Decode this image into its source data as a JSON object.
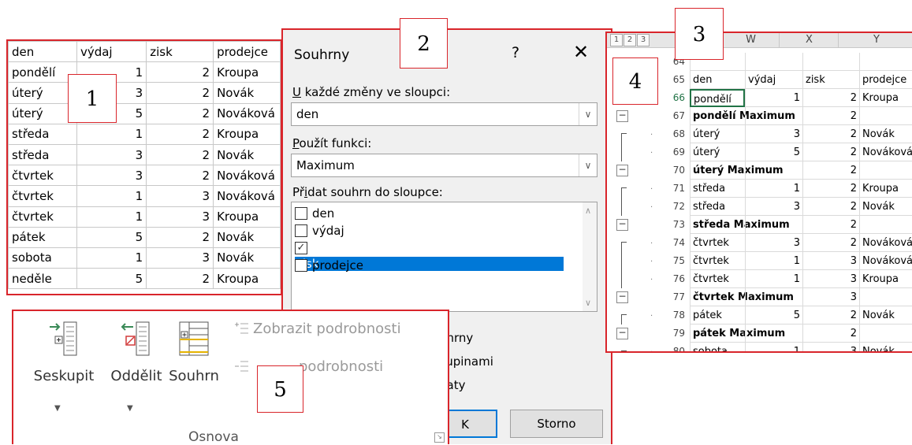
{
  "callouts": [
    "1",
    "2",
    "3",
    "4",
    "5"
  ],
  "source_table": {
    "headers": [
      "den",
      "výdaj",
      "zisk",
      "prodejce"
    ],
    "rows": [
      [
        "pondělí",
        "1",
        "2",
        "Kroupa"
      ],
      [
        "úterý",
        "3",
        "2",
        "Novák"
      ],
      [
        "úterý",
        "5",
        "2",
        "Nováková"
      ],
      [
        "středa",
        "1",
        "2",
        "Kroupa"
      ],
      [
        "středa",
        "3",
        "2",
        "Novák"
      ],
      [
        "čtvrtek",
        "3",
        "2",
        "Nováková"
      ],
      [
        "čtvrtek",
        "1",
        "3",
        "Nováková"
      ],
      [
        "čtvrtek",
        "1",
        "3",
        "Kroupa"
      ],
      [
        "pátek",
        "5",
        "2",
        "Novák"
      ],
      [
        "sobota",
        "1",
        "3",
        "Novák"
      ],
      [
        "neděle",
        "5",
        "2",
        "Kroupa"
      ]
    ]
  },
  "dialog": {
    "title": "Souhrny",
    "help": "?",
    "close": "✕",
    "change_label_key": "U",
    "change_label_rest": " každé změny ve sloupci:",
    "change_value": "den",
    "function_label_key": "P",
    "function_label_rest": "oužít funkci:",
    "function_value": "Maximum",
    "add_label_pre": "Př",
    "add_label_key": "i",
    "add_label_rest": "dat souhrn do sloupce:",
    "columns": [
      {
        "label": "den",
        "checked": false
      },
      {
        "label": "výdaj",
        "checked": false
      },
      {
        "label": "zisk",
        "checked": true
      },
      {
        "label": "prodejce",
        "checked": false
      }
    ],
    "partial_options": [
      "uhrny",
      "kupinami",
      "daty"
    ],
    "ok_label": "K",
    "cancel_label": "Storno"
  },
  "sheet": {
    "levels": [
      "1",
      "2",
      "3"
    ],
    "column_headers": [
      "W",
      "X",
      "Y"
    ],
    "rows": [
      {
        "num": "64",
        "cells": [
          "",
          "",
          "",
          ""
        ]
      },
      {
        "num": "65",
        "cells": [
          "den",
          "výdaj",
          "zisk",
          "prodejce"
        ]
      },
      {
        "num": "66",
        "cells": [
          "pondělí",
          "1",
          "2",
          "Kroupa"
        ]
      },
      {
        "num": "67",
        "cells": [
          "pondělí Maximum",
          "",
          "2",
          ""
        ],
        "summary": true
      },
      {
        "num": "68",
        "cells": [
          "úterý",
          "3",
          "2",
          "Novák"
        ]
      },
      {
        "num": "69",
        "cells": [
          "úterý",
          "5",
          "2",
          "Nováková"
        ]
      },
      {
        "num": "70",
        "cells": [
          "úterý Maximum",
          "",
          "2",
          ""
        ],
        "summary": true
      },
      {
        "num": "71",
        "cells": [
          "středa",
          "1",
          "2",
          "Kroupa"
        ]
      },
      {
        "num": "72",
        "cells": [
          "středa",
          "3",
          "2",
          "Novák"
        ]
      },
      {
        "num": "73",
        "cells": [
          "středa Maximum",
          "",
          "2",
          ""
        ],
        "summary": true
      },
      {
        "num": "74",
        "cells": [
          "čtvrtek",
          "3",
          "2",
          "Nováková"
        ]
      },
      {
        "num": "75",
        "cells": [
          "čtvrtek",
          "1",
          "3",
          "Nováková"
        ]
      },
      {
        "num": "76",
        "cells": [
          "čtvrtek",
          "1",
          "3",
          "Kroupa"
        ]
      },
      {
        "num": "77",
        "cells": [
          "čtvrtek Maximum",
          "",
          "3",
          ""
        ],
        "summary": true
      },
      {
        "num": "78",
        "cells": [
          "pátek",
          "5",
          "2",
          "Novák"
        ]
      },
      {
        "num": "79",
        "cells": [
          "pátek Maximum",
          "",
          "2",
          ""
        ],
        "summary": true
      },
      {
        "num": "80",
        "cells": [
          "sobota",
          "1",
          "3",
          "Novák"
        ]
      }
    ]
  },
  "ribbon": {
    "group_button": "Seskupit",
    "ungroup_button": "Oddělit",
    "subtotal_button": "Souhrn",
    "show_detail": "Zobrazit podrobnosti",
    "hide_detail": "podrobnosti",
    "group_name": "Osnova"
  },
  "colors": {
    "callout_border": "#d9252b",
    "selection": "#0078d7",
    "excel_green": "#217346"
  }
}
